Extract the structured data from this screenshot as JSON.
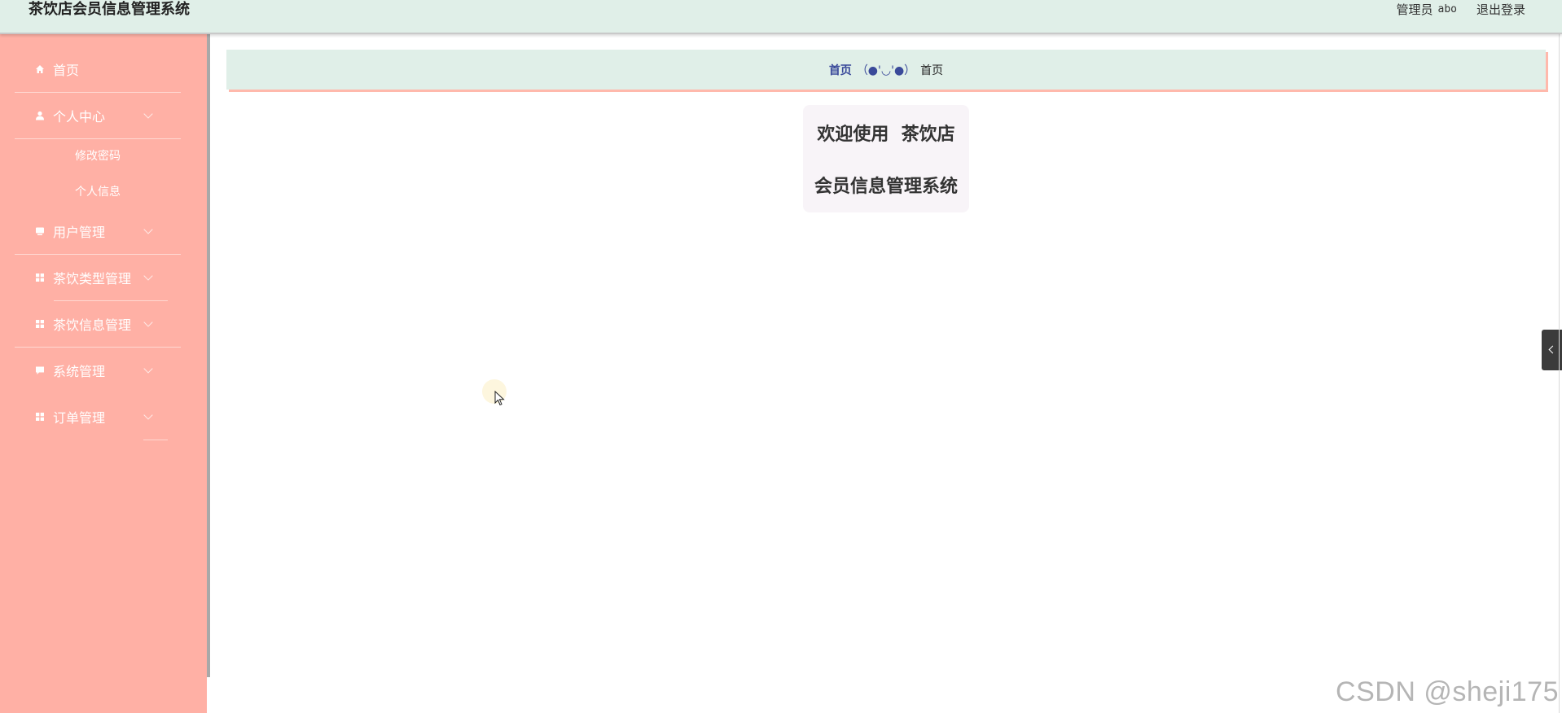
{
  "header": {
    "title": "茶饮店会员信息管理系统",
    "role_label": "管理员",
    "username": "abo",
    "logout_label": "退出登录"
  },
  "sidebar": {
    "items": [
      {
        "label": "首页",
        "icon": "home-icon"
      },
      {
        "label": "个人中心",
        "icon": "user-icon"
      },
      {
        "label": "用户管理",
        "icon": "monitor-icon"
      },
      {
        "label": "茶饮类型管理",
        "icon": "grid-icon"
      },
      {
        "label": "茶饮信息管理",
        "icon": "grid-icon"
      },
      {
        "label": "系统管理",
        "icon": "chat-icon"
      },
      {
        "label": "订单管理",
        "icon": "grid-icon"
      }
    ],
    "subitems": [
      {
        "label": "修改密码"
      },
      {
        "label": "个人信息"
      }
    ]
  },
  "breadcrumb": {
    "home": "首页",
    "separator": "（●'◡'●）",
    "current": "首页"
  },
  "welcome": {
    "line1": "欢迎使用  茶饮店",
    "line2": "会员信息管理系统"
  },
  "watermark": "CSDN @sheji175",
  "colors": {
    "header_bg": "#e0efe8",
    "sidebar_bg": "#ffb0a5",
    "accent_shadow": "#ffb9ac",
    "breadcrumb_link": "#3a4a9a"
  }
}
